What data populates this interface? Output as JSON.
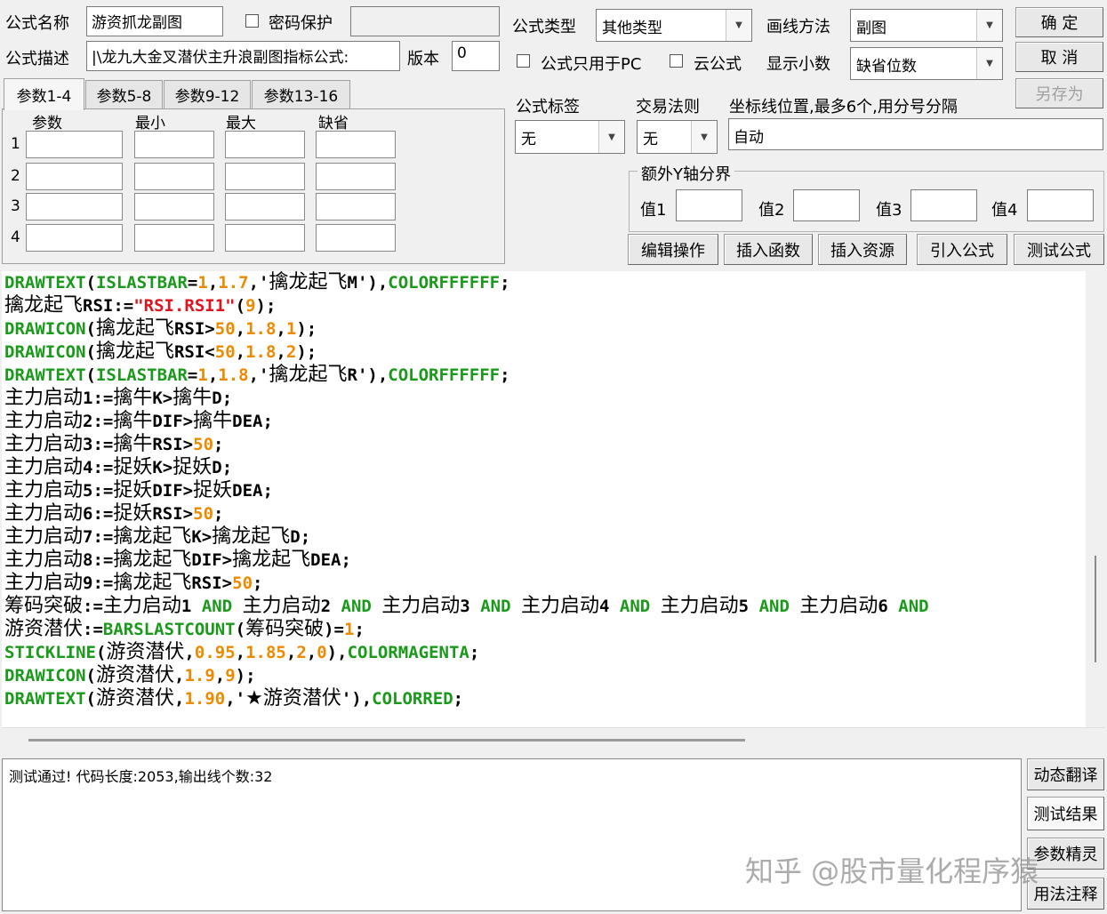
{
  "form": {
    "name_label": "公式名称",
    "name_value": "游资抓龙副图",
    "password_label": "密码保护",
    "desc_label": "公式描述",
    "desc_value": "|\\龙九大金叉潜伏主升浪副图指标公式:",
    "version_label": "版本",
    "version_value": "0",
    "type_label": "公式类型",
    "type_value": "其他类型",
    "draw_label": "画线方法",
    "draw_value": "副图",
    "pc_only_label": "公式只用于PC",
    "cloud_label": "云公式",
    "decimal_label": "显示小数",
    "decimal_value": "缺省位数",
    "tag_label": "公式标签",
    "tag_value": "无",
    "rule_label": "交易法则",
    "rule_value": "无",
    "coord_label": "坐标线位置,最多6个,用分号分隔",
    "coord_value": "自动",
    "yaxis_label": "额外Y轴分界",
    "val1": "值1",
    "val2": "值2",
    "val3": "值3",
    "val4": "值4"
  },
  "buttons": {
    "ok": "确 定",
    "cancel": "取 消",
    "save_as": "另存为",
    "edit_ops": "编辑操作",
    "insert_func": "插入函数",
    "insert_res": "插入资源",
    "import_formula": "引入公式",
    "test_formula": "测试公式",
    "dyn_translate": "动态翻译",
    "test_result": "测试结果",
    "param_wizard": "参数精灵",
    "usage_note": "用法注释"
  },
  "tabs": [
    "参数1-4",
    "参数5-8",
    "参数9-12",
    "参数13-16"
  ],
  "param_headers": [
    "参数",
    "最小",
    "最大",
    "缺省"
  ],
  "param_rows": [
    "1",
    "2",
    "3",
    "4"
  ],
  "code_lines": [
    [
      [
        "g",
        "DRAWTEXT"
      ],
      [
        "k",
        "("
      ],
      [
        "g",
        "ISLASTBAR"
      ],
      [
        "k",
        "="
      ],
      [
        "o",
        "1"
      ],
      [
        "k",
        ","
      ],
      [
        "o",
        "1.7"
      ],
      [
        "k",
        ",'"
      ],
      [
        "cn",
        "擒龙起飞"
      ],
      [
        "k",
        "M'),"
      ],
      [
        "g",
        "COLORFFFFFF"
      ],
      [
        "k",
        ";"
      ]
    ],
    [
      [
        "cn",
        "擒龙起飞"
      ],
      [
        "k",
        "RSI:="
      ],
      [
        "r",
        "\"RSI.RSI1\""
      ],
      [
        "k",
        "("
      ],
      [
        "o",
        "9"
      ],
      [
        "k",
        ");"
      ]
    ],
    [
      [
        "g",
        "DRAWICON"
      ],
      [
        "k",
        "("
      ],
      [
        "cn",
        "擒龙起飞"
      ],
      [
        "k",
        "RSI>"
      ],
      [
        "o",
        "50"
      ],
      [
        "k",
        ","
      ],
      [
        "o",
        "1.8"
      ],
      [
        "k",
        ","
      ],
      [
        "o",
        "1"
      ],
      [
        "k",
        ");"
      ]
    ],
    [
      [
        "g",
        "DRAWICON"
      ],
      [
        "k",
        "("
      ],
      [
        "cn",
        "擒龙起飞"
      ],
      [
        "k",
        "RSI<"
      ],
      [
        "o",
        "50"
      ],
      [
        "k",
        ","
      ],
      [
        "o",
        "1.8"
      ],
      [
        "k",
        ","
      ],
      [
        "o",
        "2"
      ],
      [
        "k",
        ");"
      ]
    ],
    [
      [
        "g",
        "DRAWTEXT"
      ],
      [
        "k",
        "("
      ],
      [
        "g",
        "ISLASTBAR"
      ],
      [
        "k",
        "="
      ],
      [
        "o",
        "1"
      ],
      [
        "k",
        ","
      ],
      [
        "o",
        "1.8"
      ],
      [
        "k",
        ",'"
      ],
      [
        "cn",
        "擒龙起飞"
      ],
      [
        "k",
        "R'),"
      ],
      [
        "g",
        "COLORFFFFFF"
      ],
      [
        "k",
        ";"
      ]
    ],
    [
      [
        "cn",
        "主力启动"
      ],
      [
        "k",
        "1:="
      ],
      [
        "cn",
        "擒牛"
      ],
      [
        "k",
        "K>"
      ],
      [
        "cn",
        "擒牛"
      ],
      [
        "k",
        "D;"
      ]
    ],
    [
      [
        "cn",
        "主力启动"
      ],
      [
        "k",
        "2:="
      ],
      [
        "cn",
        "擒牛"
      ],
      [
        "k",
        "DIF>"
      ],
      [
        "cn",
        "擒牛"
      ],
      [
        "k",
        "DEA;"
      ]
    ],
    [
      [
        "cn",
        "主力启动"
      ],
      [
        "k",
        "3:="
      ],
      [
        "cn",
        "擒牛"
      ],
      [
        "k",
        "RSI>"
      ],
      [
        "o",
        "50"
      ],
      [
        "k",
        ";"
      ]
    ],
    [
      [
        "cn",
        "主力启动"
      ],
      [
        "k",
        "4:="
      ],
      [
        "cn",
        "捉妖"
      ],
      [
        "k",
        "K>"
      ],
      [
        "cn",
        "捉妖"
      ],
      [
        "k",
        "D;"
      ]
    ],
    [
      [
        "cn",
        "主力启动"
      ],
      [
        "k",
        "5:="
      ],
      [
        "cn",
        "捉妖"
      ],
      [
        "k",
        "DIF>"
      ],
      [
        "cn",
        "捉妖"
      ],
      [
        "k",
        "DEA;"
      ]
    ],
    [
      [
        "cn",
        "主力启动"
      ],
      [
        "k",
        "6:="
      ],
      [
        "cn",
        "捉妖"
      ],
      [
        "k",
        "RSI>"
      ],
      [
        "o",
        "50"
      ],
      [
        "k",
        ";"
      ]
    ],
    [
      [
        "cn",
        "主力启动"
      ],
      [
        "k",
        "7:="
      ],
      [
        "cn",
        "擒龙起飞"
      ],
      [
        "k",
        "K>"
      ],
      [
        "cn",
        "擒龙起飞"
      ],
      [
        "k",
        "D;"
      ]
    ],
    [
      [
        "cn",
        "主力启动"
      ],
      [
        "k",
        "8:="
      ],
      [
        "cn",
        "擒龙起飞"
      ],
      [
        "k",
        "DIF>"
      ],
      [
        "cn",
        "擒龙起飞"
      ],
      [
        "k",
        "DEA;"
      ]
    ],
    [
      [
        "cn",
        "主力启动"
      ],
      [
        "k",
        "9:="
      ],
      [
        "cn",
        "擒龙起飞"
      ],
      [
        "k",
        "RSI>"
      ],
      [
        "o",
        "50"
      ],
      [
        "k",
        ";"
      ]
    ],
    [
      [
        "cn",
        "筹码突破"
      ],
      [
        "k",
        ":="
      ],
      [
        "cn",
        "主力启动"
      ],
      [
        "k",
        "1 "
      ],
      [
        "g",
        "AND"
      ],
      [
        "k",
        " "
      ],
      [
        "cn",
        "主力启动"
      ],
      [
        "k",
        "2 "
      ],
      [
        "g",
        "AND"
      ],
      [
        "k",
        " "
      ],
      [
        "cn",
        "主力启动"
      ],
      [
        "k",
        "3 "
      ],
      [
        "g",
        "AND"
      ],
      [
        "k",
        " "
      ],
      [
        "cn",
        "主力启动"
      ],
      [
        "k",
        "4 "
      ],
      [
        "g",
        "AND"
      ],
      [
        "k",
        " "
      ],
      [
        "cn",
        "主力启动"
      ],
      [
        "k",
        "5 "
      ],
      [
        "g",
        "AND"
      ],
      [
        "k",
        " "
      ],
      [
        "cn",
        "主力启动"
      ],
      [
        "k",
        "6 "
      ],
      [
        "g",
        "AND"
      ]
    ],
    [
      [
        "cn",
        "游资潜伏"
      ],
      [
        "k",
        ":="
      ],
      [
        "g",
        "BARSLASTCOUNT"
      ],
      [
        "k",
        "("
      ],
      [
        "cn",
        "筹码突破"
      ],
      [
        "k",
        ")="
      ],
      [
        "o",
        "1"
      ],
      [
        "k",
        ";"
      ]
    ],
    [
      [
        "g",
        "STICKLINE"
      ],
      [
        "k",
        "("
      ],
      [
        "cn",
        "游资潜伏"
      ],
      [
        "k",
        ","
      ],
      [
        "o",
        "0.95"
      ],
      [
        "k",
        ","
      ],
      [
        "o",
        "1.85"
      ],
      [
        "k",
        ","
      ],
      [
        "o",
        "2"
      ],
      [
        "k",
        ","
      ],
      [
        "o",
        "0"
      ],
      [
        "k",
        "),"
      ],
      [
        "g",
        "COLORMAGENTA"
      ],
      [
        "k",
        ";"
      ]
    ],
    [
      [
        "g",
        "DRAWICON"
      ],
      [
        "k",
        "("
      ],
      [
        "cn",
        "游资潜伏"
      ],
      [
        "k",
        ","
      ],
      [
        "o",
        "1.9"
      ],
      [
        "k",
        ","
      ],
      [
        "o",
        "9"
      ],
      [
        "k",
        ");"
      ]
    ],
    [
      [
        "g",
        "DRAWTEXT"
      ],
      [
        "k",
        "("
      ],
      [
        "cn",
        "游资潜伏"
      ],
      [
        "k",
        ","
      ],
      [
        "o",
        "1.90"
      ],
      [
        "k",
        ",'"
      ],
      [
        "cn",
        "★游资潜伏"
      ],
      [
        "k",
        "'),"
      ],
      [
        "g",
        "COLORRED"
      ],
      [
        "k",
        ";"
      ]
    ]
  ],
  "output_text": "测试通过! 代码长度:2053,输出线个数:32",
  "watermark": "知乎 @股市量化程序猿"
}
